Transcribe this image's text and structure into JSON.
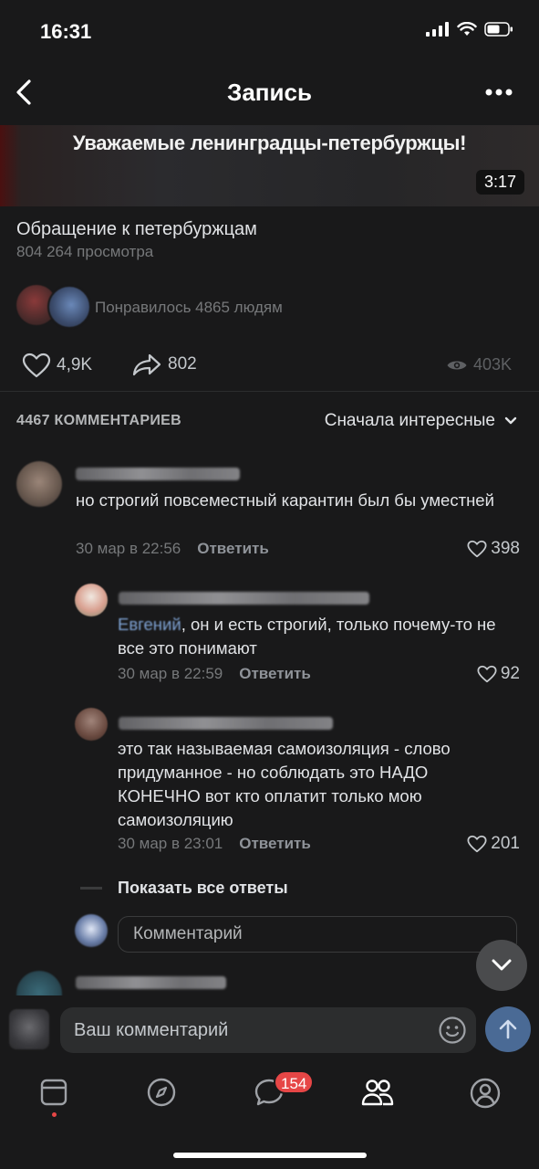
{
  "status_bar": {
    "time": "16:31"
  },
  "header": {
    "title": "Запись"
  },
  "video": {
    "caption": "Уважаемые ленинградцы-петербуржцы!",
    "duration": "3:17"
  },
  "post": {
    "title": "Обращение к петербуржцам",
    "views": "804 264 просмотра",
    "liked_by": "Понравилось 4865 людям",
    "likes": "4,9K",
    "shares": "802",
    "view_count": "403K"
  },
  "comments_header": {
    "count": "4467 КОММЕНТАРИЕВ",
    "sort": "Сначала интересные"
  },
  "comments": [
    {
      "text": "но строгий повсеместный карантин был бы уместней",
      "date": "30 мар в 22:56",
      "reply_label": "Ответить",
      "likes": "398"
    },
    {
      "mention": "Евгений",
      "text": ", он и есть строгий, только почему-то не все это понимают",
      "date": "30 мар в 22:59",
      "reply_label": "Ответить",
      "likes": "92"
    },
    {
      "text": "это так называемая самоизоляция - слово придуманное - но соблюдать это НАДО КОНЕЧНО вот кто оплатит только мою самоизоляцию",
      "date": "30 мар в 23:01",
      "reply_label": "Ответить",
      "likes": "201"
    }
  ],
  "show_all_replies": "Показать все ответы",
  "reply_input": {
    "placeholder": "Комментарий"
  },
  "composer": {
    "placeholder": "Ваш комментарий"
  },
  "tabbar": {
    "messages_badge": "154"
  },
  "colors": {
    "background": "#19191a",
    "accent": "#4a6a95",
    "badge": "#e64646"
  }
}
